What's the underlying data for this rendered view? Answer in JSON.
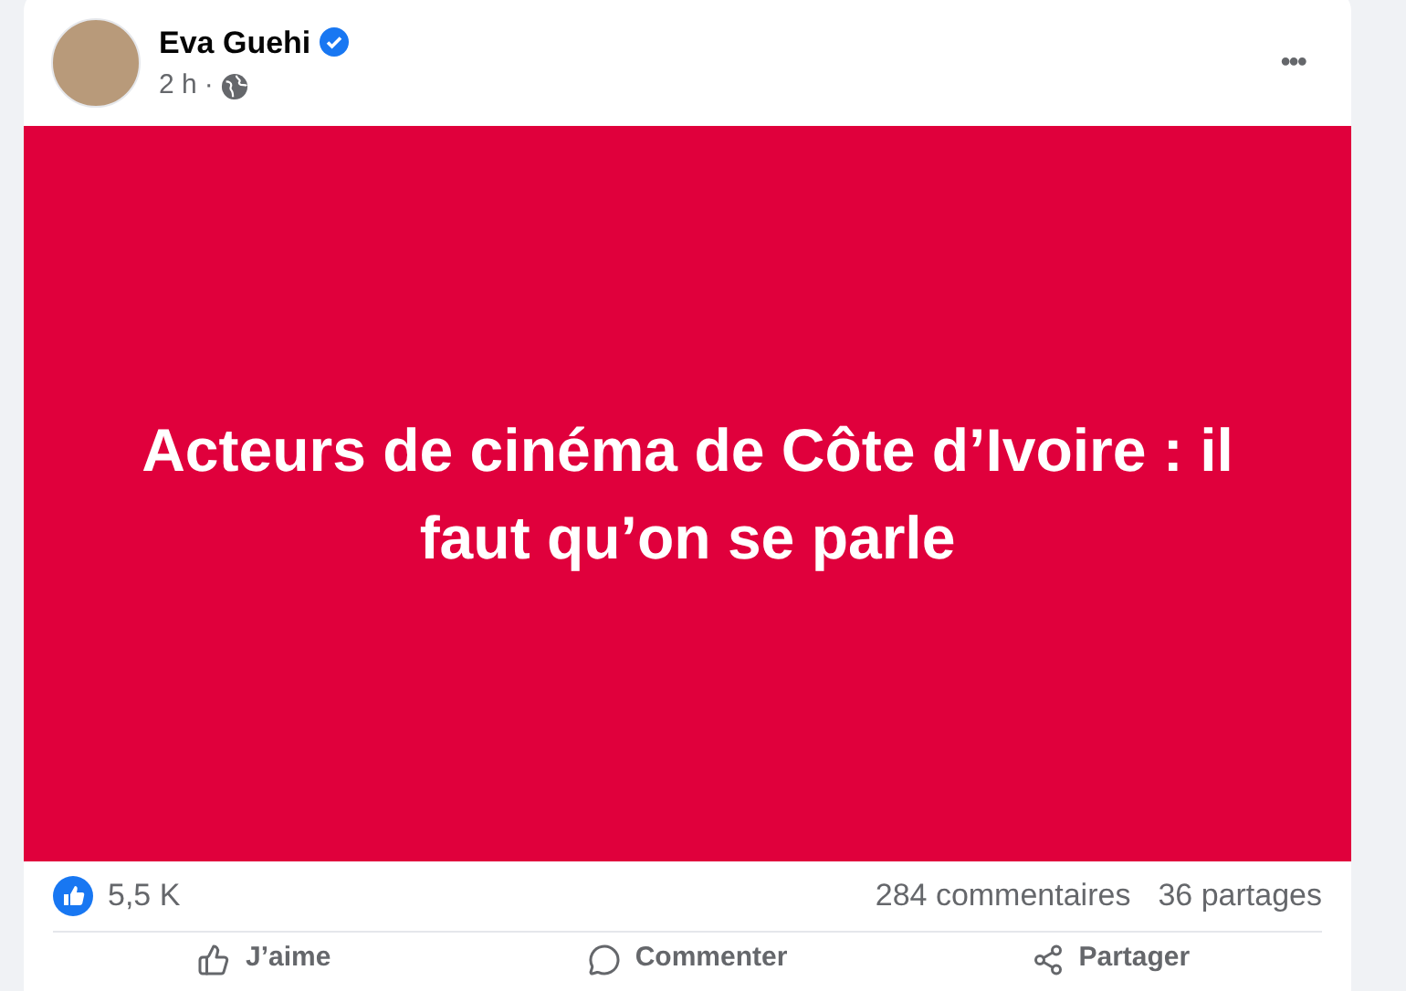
{
  "post": {
    "author": "Eva Guehi",
    "verified": true,
    "time": "2 h",
    "separator": "·",
    "menu": "•••",
    "text": "Acteurs de cinéma de Côte d’Ivoire : il faut qu’on se parle"
  },
  "stats": {
    "reactions": "5,5 K",
    "comments": "284 commentaires",
    "shares": "36 partages"
  },
  "actions": [
    {
      "kind": "like",
      "label": "J’aime"
    },
    {
      "kind": "comment",
      "label": "Commenter"
    },
    {
      "kind": "share",
      "label": "Partager"
    }
  ]
}
